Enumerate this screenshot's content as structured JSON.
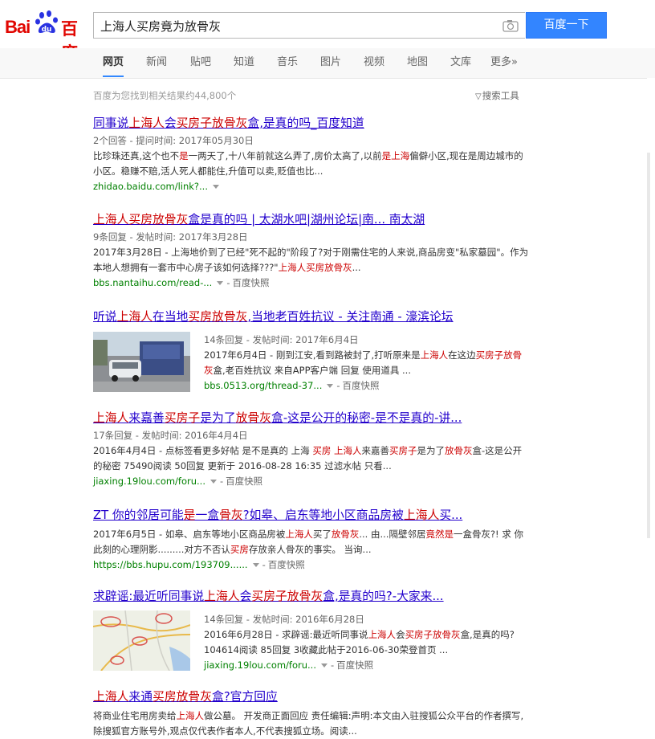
{
  "brand": {
    "logo_left": "Bai",
    "logo_right": "百度",
    "logo_alt": "Baidu 百度"
  },
  "search": {
    "query": "上海人买房竟为放骨灰",
    "button_label": "百度一下"
  },
  "nav_tabs": [
    {
      "label": "网页",
      "active": true
    },
    {
      "label": "新闻"
    },
    {
      "label": "贴吧"
    },
    {
      "label": "知道"
    },
    {
      "label": "音乐"
    },
    {
      "label": "图片"
    },
    {
      "label": "视频"
    },
    {
      "label": "地图"
    },
    {
      "label": "文库"
    },
    {
      "label": "更多»"
    }
  ],
  "meta": {
    "result_count": "百度为您找到相关结果约44,800个",
    "search_tools": "搜索工具"
  },
  "results": [
    {
      "title": [
        [
          "同事说",
          false
        ],
        [
          "上海人",
          true
        ],
        [
          "会",
          false
        ],
        [
          "买房子放骨灰",
          true
        ],
        [
          "盒,是真的吗_百度知道",
          false
        ]
      ],
      "meta": "2个回答 - 提问时间: 2017年05月30日",
      "desc": [
        [
          "比珍珠还真,这个也不",
          false
        ],
        [
          "是",
          true
        ],
        [
          "一两天了,十八年前就这么弄了,房价太高了,以前",
          false
        ],
        [
          "是上海",
          true
        ],
        [
          "偏僻小区,现在是周边城市的小区。稳赚不赔,活人死人都能住,升值可以卖,贬值也比...",
          false
        ]
      ],
      "url": "zhidao.baidu.com/link?...",
      "snapshot": ""
    },
    {
      "title": [
        [
          "上海人买房放骨灰",
          true
        ],
        [
          "盒是真的吗 | 太湖水吧|湖州论坛|南... 南太湖",
          false
        ]
      ],
      "meta": "9条回复 - 发帖时间: 2017年3月28日",
      "desc": [
        [
          "2017年3月28日 - 上海地价到了已经\"死不起的\"阶段了?对于刚需住宅的人来说,商品房变\"私家墓园\"。作为本地人想拥有一套市中心房子该如何选择???\"",
          false
        ],
        [
          "上海人买房放骨灰",
          true
        ],
        [
          "...",
          false
        ]
      ],
      "url": "bbs.nantaihu.com/read-...",
      "snapshot": "百度快照"
    },
    {
      "title": [
        [
          "听说",
          false
        ],
        [
          "上海人",
          true
        ],
        [
          "在当地",
          false
        ],
        [
          "买房放骨灰",
          true
        ],
        [
          ",当地老百姓抗议 - 关注南通 - 濠滨论坛",
          false
        ]
      ],
      "meta": "14条回复 - 发帖时间: 2017年6月4日",
      "desc": [
        [
          "2017年6月4日 - 刚到江安,看到路被封了,打听原来是",
          false
        ],
        [
          "上海人",
          true
        ],
        [
          "在这边",
          false
        ],
        [
          "买房子放骨灰",
          true
        ],
        [
          "盒,老百姓抗议 来自APP客户端 回复 使用道具 ...",
          false
        ]
      ],
      "url": "bbs.0513.org/thread-37...",
      "snapshot": "百度快照"
    },
    {
      "title": [
        [
          "上海人",
          true
        ],
        [
          "来嘉善",
          false
        ],
        [
          "买房子",
          true
        ],
        [
          "是为了",
          false
        ],
        [
          "放骨灰",
          true
        ],
        [
          "盒-这是公开的秘密-是不是真的-讲...",
          false
        ]
      ],
      "meta": "17条回复 - 发帖时间: 2016年4月4日",
      "desc": [
        [
          "2016年4月4日 - 点标签看更多好帖 是不是真的 上海 ",
          false
        ],
        [
          "买房",
          true
        ],
        [
          " ",
          false
        ],
        [
          "上海人",
          true
        ],
        [
          "来嘉善",
          false
        ],
        [
          "买房子",
          true
        ],
        [
          "是为了",
          false
        ],
        [
          "放骨灰",
          true
        ],
        [
          "盒-这是公开的秘密 75490阅读 50回复 更新于 2016-08-28 16:35 过滤水帖 只看...",
          false
        ]
      ],
      "url": "jiaxing.19lou.com/foru...",
      "snapshot": "百度快照"
    },
    {
      "title": [
        [
          "ZT 你的邻居可能",
          false
        ],
        [
          "是",
          true
        ],
        [
          "一盒",
          false
        ],
        [
          "骨灰",
          true
        ],
        [
          "?如皋、启东等地小区商品房被",
          false
        ],
        [
          "上海人",
          true
        ],
        [
          "买...",
          false
        ]
      ],
      "meta": "",
      "desc": [
        [
          "2017年6月5日 - 如皋、启东等地小区商品房被",
          false
        ],
        [
          "上海人",
          true
        ],
        [
          "买了",
          false
        ],
        [
          "放骨灰",
          true
        ],
        [
          "... 由...隔壁邻居",
          false
        ],
        [
          "竟然是",
          true
        ],
        [
          "一盒骨灰?! 求 你此刻的心理阴影.........对方不否认",
          false
        ],
        [
          "买房",
          true
        ],
        [
          "存放亲人骨灰的事实。 当询...",
          false
        ]
      ],
      "url": "https://bbs.hupu.com/193709......",
      "snapshot": "百度快照"
    },
    {
      "title": [
        [
          "求辟谣:最近听同事说",
          false
        ],
        [
          "上海人",
          true
        ],
        [
          "会",
          false
        ],
        [
          "买房子放骨灰",
          true
        ],
        [
          "盒,是真的吗?-大家来...",
          false
        ]
      ],
      "meta": "14条回复 - 发帖时间: 2016年6月28日",
      "desc": [
        [
          "2016年6月28日 - 求辟谣:最近听同事说",
          false
        ],
        [
          "上海人",
          true
        ],
        [
          "会",
          false
        ],
        [
          "买房子放骨灰",
          true
        ],
        [
          "盒,是真的吗?104614阅读 85回复 3收藏此帖于2016-06-30荣登首页 ...",
          false
        ]
      ],
      "url": "jiaxing.19lou.com/foru...",
      "snapshot": "百度快照"
    },
    {
      "title": [
        [
          "上海人",
          true
        ],
        [
          "来通",
          false
        ],
        [
          "买房放骨灰",
          true
        ],
        [
          "盒?官方回应",
          false
        ]
      ],
      "meta": "",
      "desc": [
        [
          "将商业住宅用房卖给",
          false
        ],
        [
          "上海人",
          true
        ],
        [
          "做公墓。 开发商正面回应 责任编辑:声明:本文由入驻搜狐公众平台的作者撰写,除搜狐官方账号外,观点仅代表作者本人,不代表搜狐立场。阅读...",
          false
        ]
      ],
      "url": "",
      "snapshot": ""
    }
  ],
  "colors": {
    "link": "#2200cc",
    "highlight": "#cc0000",
    "url_green": "#008000",
    "button_blue": "#3385ff",
    "brand_red": "#e10601"
  }
}
